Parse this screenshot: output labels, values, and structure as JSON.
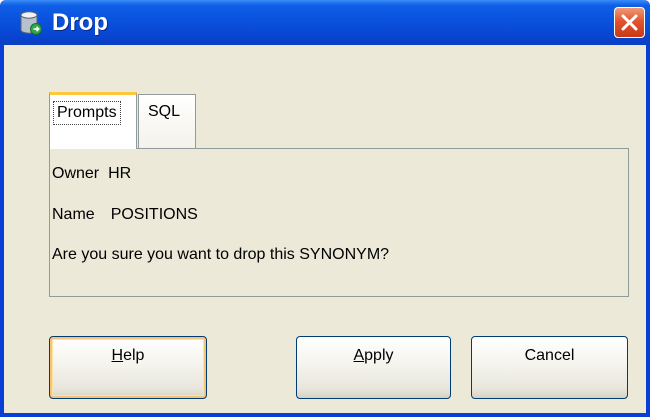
{
  "window": {
    "title": "Drop",
    "title_icon": "database-icon",
    "close_icon": "close-icon"
  },
  "tabs": [
    {
      "label": "Prompts",
      "selected": true
    },
    {
      "label": "SQL",
      "selected": false
    }
  ],
  "prompts": {
    "owner_label": "Owner",
    "owner_value": "HR",
    "name_label": "Name",
    "name_value": "POSITIONS",
    "question": "Are you sure you want to drop this SYNONYM?"
  },
  "buttons": {
    "help": {
      "mnemonic": "H",
      "rest": "elp"
    },
    "apply": {
      "mnemonic": "A",
      "rest": "pply"
    },
    "cancel": "Cancel"
  },
  "colors": {
    "titlebar": "#0a52de",
    "dialog_bg": "#ece9d8",
    "close_button": "#e2542f",
    "focus_accent": "#ffc83c"
  }
}
